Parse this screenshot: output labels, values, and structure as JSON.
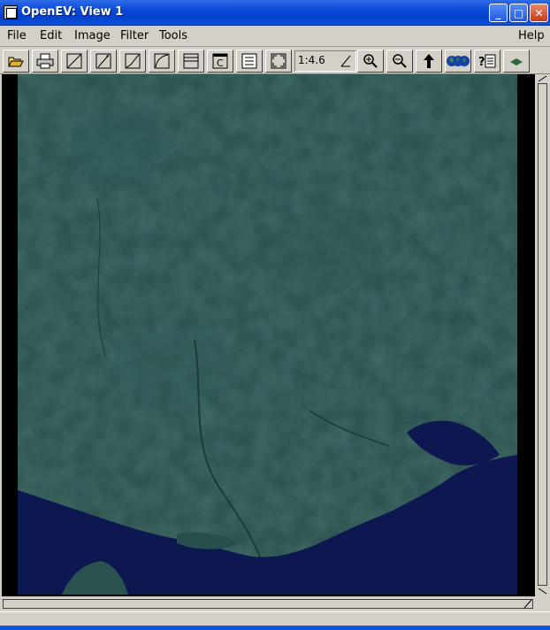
{
  "window": {
    "title": "OpenEV: View 1",
    "controls": {
      "minimize": "_",
      "maximize": "□",
      "close": "✕"
    }
  },
  "menu": {
    "items": [
      "File",
      "Edit",
      "Image",
      "Filter",
      "Tools"
    ],
    "help": "Help"
  },
  "toolbar": {
    "zoom_value": "1:4.6",
    "buttons": [
      "open-file-icon",
      "print-icon",
      "draw-line-icon",
      "edit-line-icon",
      "draw-curve-icon",
      "draw-arc-icon",
      "draw-rect-icon",
      "text-c-icon",
      "list-icon",
      "fit-extent-icon",
      "zoom-in-icon",
      "zoom-out-icon",
      "arrow-up-icon",
      "globe-icon",
      "help-query-icon",
      "3d-view-icon"
    ]
  },
  "colors": {
    "titlebar": "#0a49d8",
    "chrome": "#d4d0c8",
    "land": "#284e4b",
    "water": "#0d1750"
  }
}
